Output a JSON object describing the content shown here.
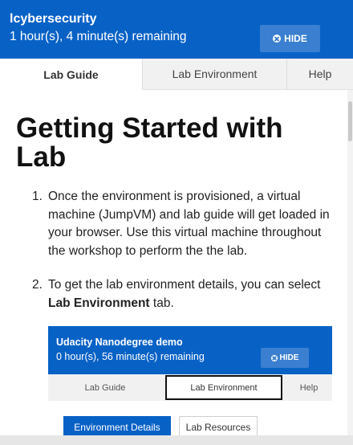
{
  "header": {
    "title": "lcybersecurity",
    "remaining": "1 hour(s), 4 minute(s) remaining",
    "hide_label": "HIDE"
  },
  "tabs": [
    {
      "label": "Lab Guide",
      "active": true
    },
    {
      "label": "Lab Environment",
      "active": false
    },
    {
      "label": "Help",
      "active": false
    }
  ],
  "guide": {
    "title": "Getting Started with Lab",
    "steps": [
      {
        "num": "1.",
        "text": "Once the environment is provisioned, a virtual machine (JumpVM) and lab guide will get loaded in your browser. Use this virtual machine throughout the workshop to perform the the lab."
      },
      {
        "num": "2.",
        "text_before": "To get the lab environment details, you can select ",
        "bold": "Lab Environment",
        "text_after": " tab."
      }
    ]
  },
  "embedded_screenshot": {
    "title": "Udacity Nanodegree demo",
    "remaining": "0 hour(s), 56 minute(s) remaining",
    "hide_label": "HIDE",
    "tabs": [
      {
        "label": "Lab Guide"
      },
      {
        "label": "Lab Environment",
        "highlighted": true
      },
      {
        "label": "Help"
      }
    ],
    "buttons": [
      {
        "label": "Environment Details",
        "active": true
      },
      {
        "label": "Lab Resources",
        "active": false
      }
    ]
  },
  "colors": {
    "header_bg": "#0862c6",
    "hide_button_bg": "#3a7fd0",
    "tab_bar_bg": "#f1f1f1"
  },
  "icons": {
    "hide": "close-circle-icon"
  }
}
